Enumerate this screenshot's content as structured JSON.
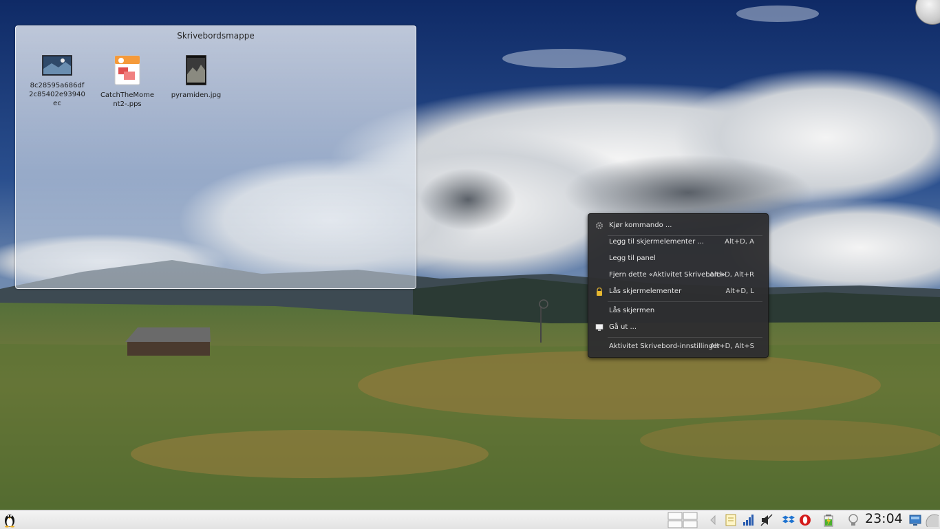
{
  "folderview": {
    "title": "Skrivebordsmappe",
    "files": [
      {
        "name": "8c28595a686df2c85402e93940ec",
        "icon": "image-thumbnail-icon"
      },
      {
        "name": "CatchTheMoment2-.pps",
        "icon": "presentation-file-icon"
      },
      {
        "name": "pyramiden.jpg",
        "icon": "image-thumbnail-icon"
      }
    ]
  },
  "context_menu": {
    "items": [
      {
        "label": "Kjør kommando ...",
        "shortcut": "",
        "icon": "run-command-gear-icon"
      },
      {
        "label": "Legg til skjermelementer ...",
        "shortcut": "Alt+D, A",
        "icon": ""
      },
      {
        "label": "Legg til panel",
        "shortcut": "",
        "icon": ""
      },
      {
        "label": "Fjern dette «Aktivitet Skrivebord»",
        "shortcut": "Alt+D, Alt+R",
        "icon": ""
      },
      {
        "label": "Lås skjermelementer",
        "shortcut": "Alt+D, L",
        "icon": "lock-icon"
      },
      {
        "label": "Lås skjermen",
        "shortcut": "",
        "icon": ""
      },
      {
        "label": "Gå ut ...",
        "shortcut": "",
        "icon": "monitor-logout-icon"
      },
      {
        "label": "Aktivitet Skrivebord-innstillinger",
        "shortcut": "Alt+D, Alt+S",
        "icon": ""
      }
    ]
  },
  "panel": {
    "launcher_icon": "tux-penguin-icon",
    "clock": "23:04",
    "tray_icons": [
      "pager-icon",
      "arrow-left-icon",
      "notes-icon",
      "network-signal-icon",
      "mute-volume-icon",
      "dropbox-icon",
      "opera-icon",
      "battery-icon",
      "lightbulb-icon",
      "show-desktop-icon"
    ]
  },
  "colors": {
    "menu_bg": "#2e2e30",
    "panel_bg": "#e8e8e8",
    "sky": "#24407a",
    "grass": "#4a6a2a"
  }
}
